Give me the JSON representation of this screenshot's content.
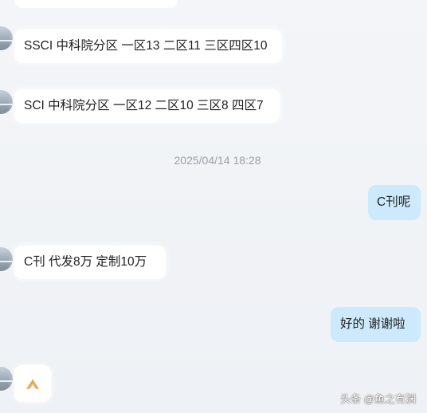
{
  "timestamp": "2025/04/14 18:28",
  "messages": [
    {
      "side": "left",
      "text": "SSCI 中科院分区 一区13 二区11 三区四区10"
    },
    {
      "side": "left",
      "text": "SCI 中科院分区 一区12 二区10 三区8 四区7"
    },
    {
      "side": "right",
      "text": "C刊呢"
    },
    {
      "side": "left",
      "text": "C刊  代发8万  定制10万"
    },
    {
      "side": "right",
      "text": "好的  谢谢啦"
    },
    {
      "side": "left",
      "icon": "praying-hands-icon"
    }
  ],
  "watermark": "头条 @鱼之有渊",
  "colors": {
    "left_bubble": "#ffffff",
    "right_bubble": "#cdeafc",
    "background": "#f1f3f7",
    "timestamp_text": "#9a9ea6"
  }
}
